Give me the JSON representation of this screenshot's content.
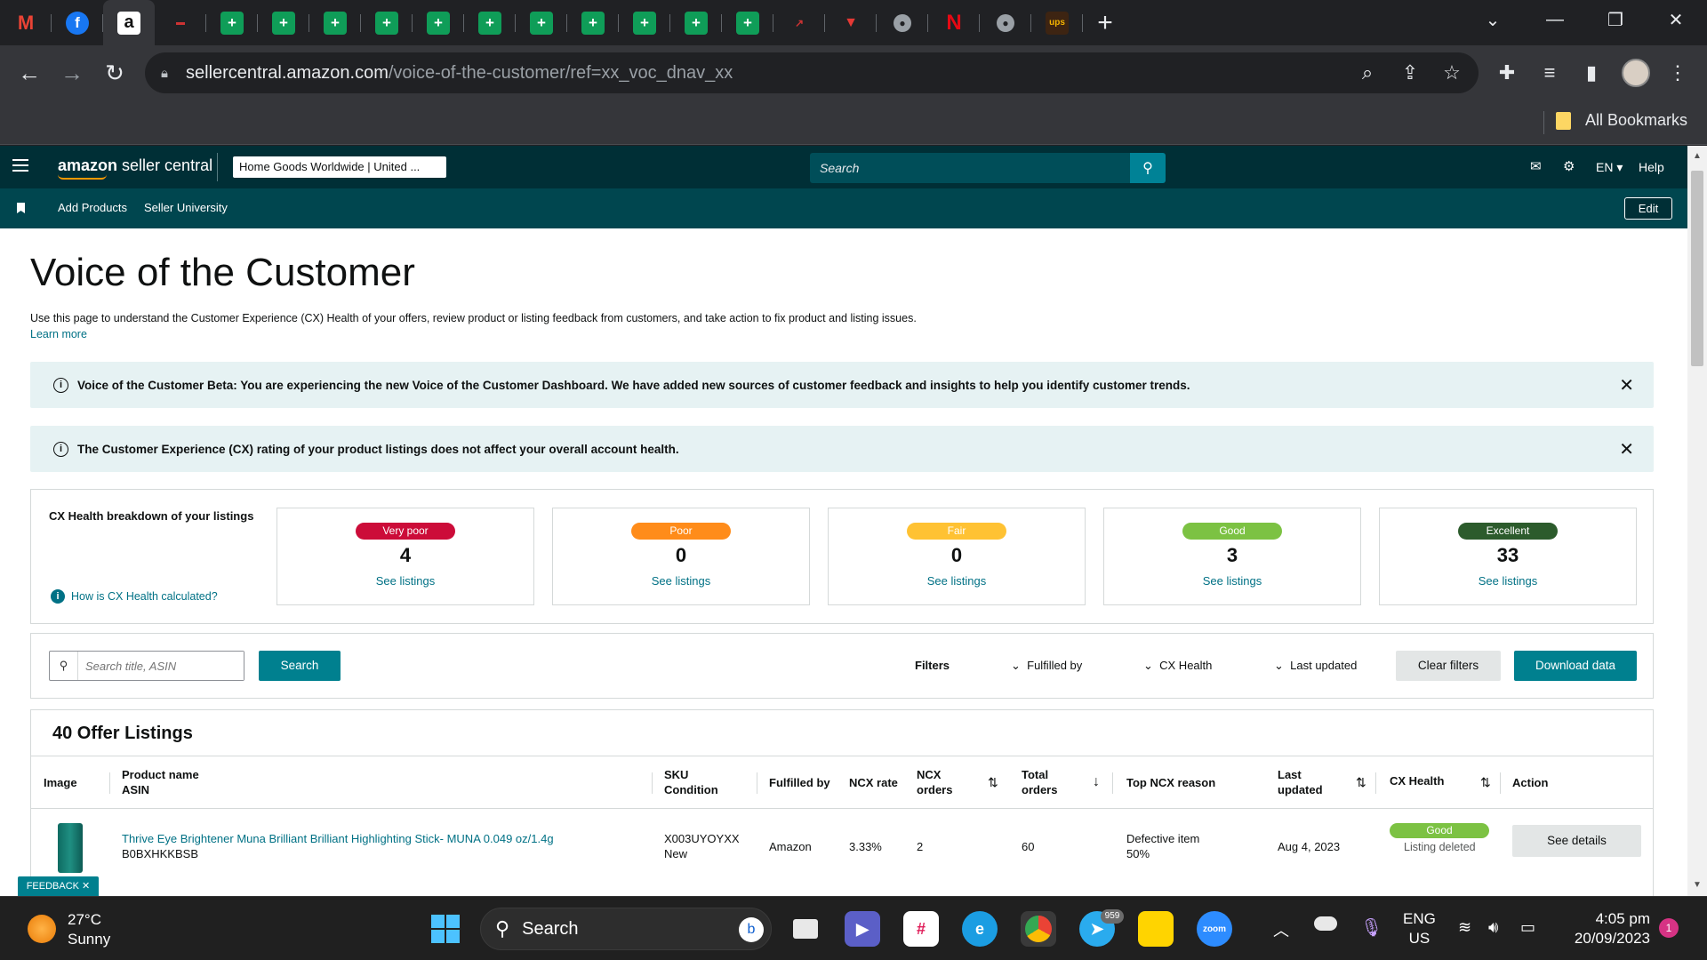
{
  "browser": {
    "url_domain": "sellercentral.amazon.com",
    "url_path": "/voice-of-the-customer/ref=xx_voc_dnav_xx",
    "bookmarks_label": "All Bookmarks",
    "tab_icons": [
      "gmail-icon",
      "facebook-icon",
      "amazon-icon",
      "flag-tab-icon",
      "sheets-icon",
      "sheets-icon",
      "sheets-icon",
      "sheets-icon",
      "sheets-icon",
      "sheets-icon",
      "sheets-icon",
      "sheets-icon",
      "sheets-icon",
      "sheets-icon",
      "sheets-icon",
      "chart-tab-icon",
      "red-tab-icon",
      "globe-icon",
      "netflix-icon",
      "globe-icon",
      "ups-icon"
    ]
  },
  "header": {
    "logo_amazon": "amazon",
    "logo_rest": " seller central",
    "store_name": "Home Goods Worldwide",
    "store_region": "United ...",
    "search_placeholder": "Search",
    "lang": "EN",
    "help": "Help"
  },
  "subnav": {
    "items": [
      "Add Products",
      "Seller University"
    ],
    "edit": "Edit"
  },
  "page": {
    "title": "Voice of the Customer",
    "description": "Use this page to understand the Customer Experience (CX) Health of your offers, review product or listing feedback from customers, and take action to fix product and listing issues.",
    "learn_more": "Learn more",
    "alert1": "Voice of the Customer Beta: You are experiencing the new Voice of the Customer Dashboard. We have added new sources of customer feedback and insights to help you identify customer trends.",
    "alert2": "The Customer Experience (CX) rating of your product listings does not affect your overall account health."
  },
  "cx_health": {
    "label": "CX Health breakdown of your listings",
    "how_link": "How is CX Health calculated?",
    "see_listings": "See listings",
    "cards": [
      {
        "label": "Very poor",
        "count": "4",
        "color": "#cc0c39"
      },
      {
        "label": "Poor",
        "count": "0",
        "color": "#ff8c1a"
      },
      {
        "label": "Fair",
        "count": "0",
        "color": "#ffc233"
      },
      {
        "label": "Good",
        "count": "3",
        "color": "#7cc243"
      },
      {
        "label": "Excellent",
        "count": "33",
        "color": "#2c5b2c"
      }
    ]
  },
  "filters": {
    "search_placeholder": "Search title, ASIN",
    "search_btn": "Search",
    "filters_label": "Filters",
    "fulfilled_by": "Fulfilled by",
    "cx_health": "CX Health",
    "last_updated": "Last updated",
    "clear": "Clear filters",
    "download": "Download data"
  },
  "listings": {
    "title": "40 Offer Listings",
    "columns": {
      "image": "Image",
      "product": "Product name",
      "asin": "ASIN",
      "sku": "SKU",
      "condition": "Condition",
      "fulfilled": "Fulfilled by",
      "ncx_rate": "NCX rate",
      "ncx_orders_1": "NCX",
      "ncx_orders_2": "orders",
      "total_1": "Total",
      "total_2": "orders",
      "top_reason": "Top NCX reason",
      "last_1": "Last",
      "last_2": "updated",
      "cx_health": "CX Health",
      "action": "Action"
    },
    "rows": [
      {
        "product": "Thrive Eye Brightener Muna Brilliant Brilliant Highlighting Stick- MUNA 0.049 oz/1.4g",
        "asin": "B0BXHKKBSB",
        "sku": "X003UYOYXX",
        "condition": "New",
        "fulfilled": "Amazon",
        "ncx_rate": "3.33%",
        "ncx_orders": "2",
        "total_orders": "60",
        "reason": "Defective item",
        "reason_pct": "50%",
        "last_updated": "Aug 4, 2023",
        "health": "Good",
        "health_note": "Listing deleted",
        "action": "See details"
      }
    ]
  },
  "feedback": "FEEDBACK ✕",
  "taskbar": {
    "temp": "27°C",
    "weather": "Sunny",
    "search": "Search",
    "lang1": "ENG",
    "lang2": "US",
    "time": "4:05 pm",
    "date": "20/09/2023",
    "notif": "1",
    "telegram_badge": "959"
  }
}
